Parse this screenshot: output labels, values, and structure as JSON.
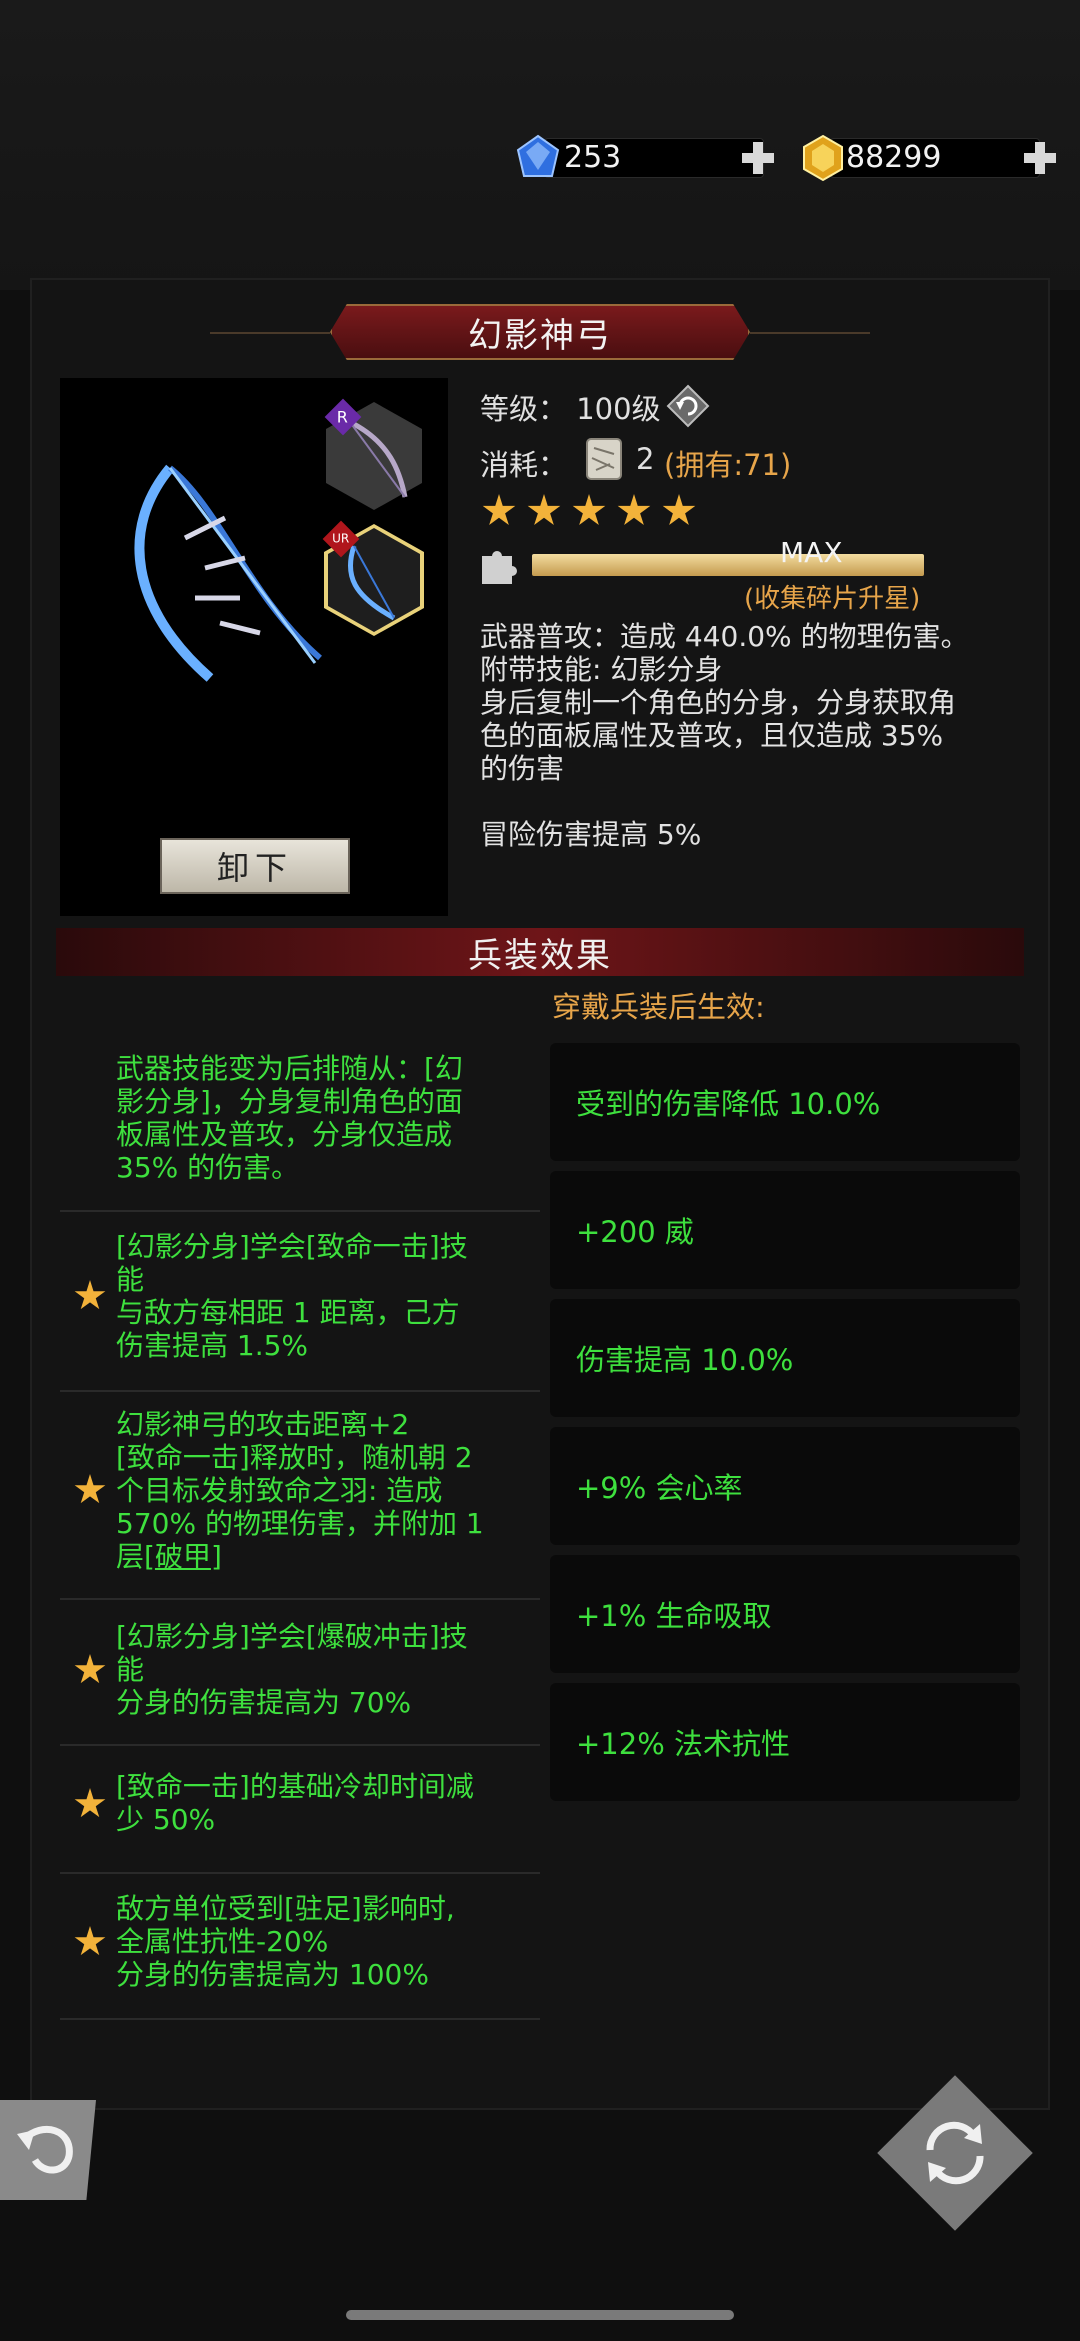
{
  "currency": {
    "gems": "253",
    "gold": "88299"
  },
  "item": {
    "title": "幻影神弓",
    "level_label": "等级：",
    "level_value": "100级",
    "cost_label": "消耗：",
    "cost_count": "2",
    "cost_owned": "(拥有:71)",
    "stars": 5,
    "progress_label": "MAX",
    "progress_fraction": 1.0,
    "progress_hint": "(收集碎片升星)",
    "rarity_tags": [
      "R",
      "UR"
    ],
    "desc_lines": [
      "武器普攻：造成 440.0% 的物理伤害。",
      "附带技能: 幻影分身",
      "身后复制一个角色的分身，分身获取角",
      "色的面板属性及普攻，且仅造成 35%",
      "的伤害"
    ],
    "bonus": "冒险伤害提高 5%",
    "unequip_label": "卸下"
  },
  "effects": {
    "header": "兵装效果",
    "subheader": "穿戴兵装后生效:",
    "list": [
      {
        "star": false,
        "lines": [
          "武器技能变为后排随从：[幻",
          "影分身]，分身复制角色的面",
          "板属性及普攻，分身仅造成",
          "35% 的伤害。"
        ]
      },
      {
        "star": true,
        "lines": [
          "[幻影分身]学会[致命一击]技",
          "能",
          "与敌方每相距 1 距离，己方",
          "伤害提高 1.5%"
        ]
      },
      {
        "star": true,
        "lines": [
          "幻影神弓的攻击距离+2",
          "[致命一击]释放时，随机朝 2",
          "个目标发射致命之羽: 造成",
          "570% 的物理伤害，并附加 1"
        ],
        "tail_prefix": "层[",
        "tail_link": "破甲",
        "tail_suffix": "]"
      },
      {
        "star": true,
        "lines": [
          "[幻影分身]学会[爆破冲击]技",
          "能",
          "分身的伤害提高为 70%"
        ]
      },
      {
        "star": true,
        "lines": [
          "[致命一击]的基础冷却时间减",
          "少 50%"
        ]
      },
      {
        "star": true,
        "lines": [
          "敌方单位受到[驻足]影响时,",
          "全属性抗性-20%",
          "分身的伤害提高为 100%"
        ]
      }
    ],
    "stats": [
      "受到的伤害降低 10.0%",
      "+200 威",
      "伤害提高 10.0%",
      "+9% 会心率",
      "+1% 生命吸取",
      "+12% 法术抗性"
    ]
  },
  "colors": {
    "effect_green": "#3ee03e",
    "accent_orange": "#e7a54a",
    "star_gold": "#f2b23a",
    "title_red": "#7a1a1c"
  },
  "icons": [
    "gem-icon",
    "gold-icon",
    "plus-icon",
    "reset-icon",
    "fragment-icon",
    "puzzle-icon",
    "back-arrow-icon",
    "swap-icon"
  ]
}
